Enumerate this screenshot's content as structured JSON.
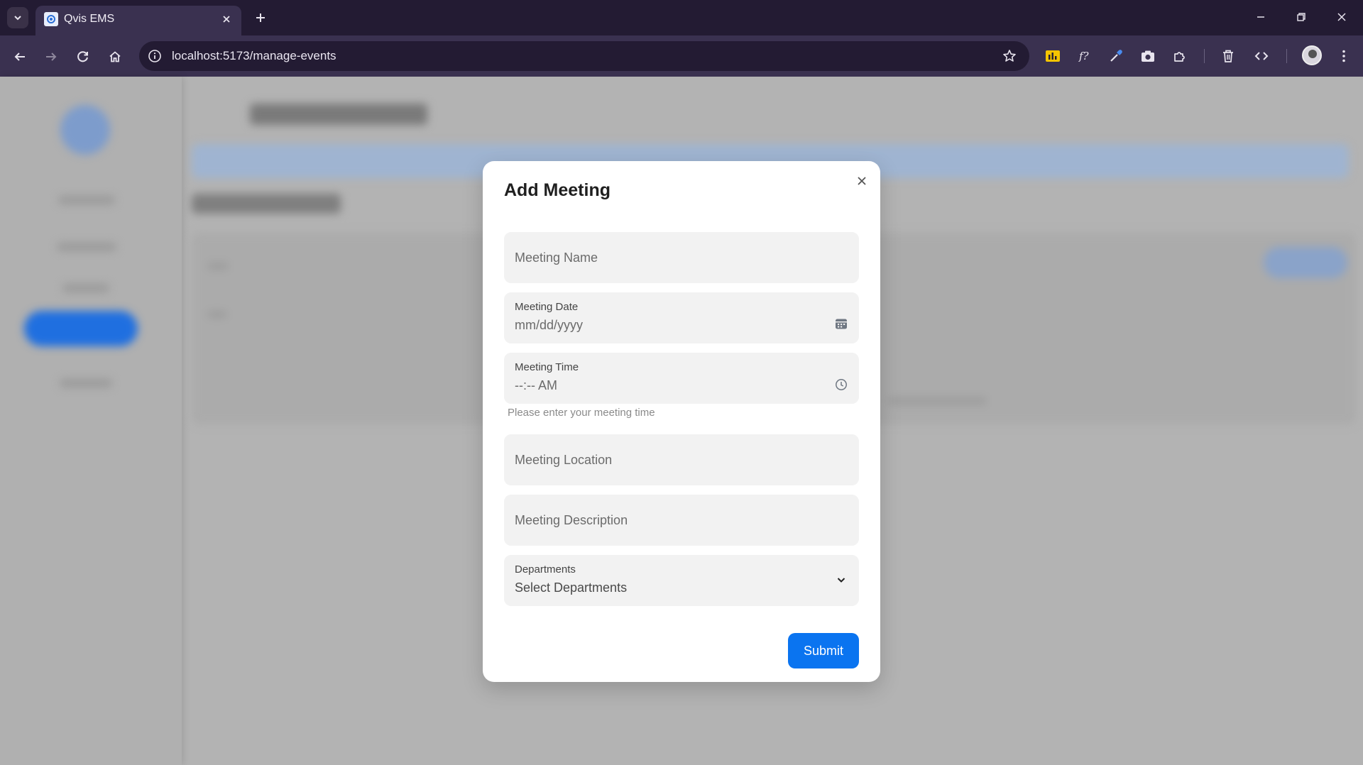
{
  "browser": {
    "tab_title": "Qvis EMS",
    "url": "localhost:5173/manage-events"
  },
  "modal": {
    "title": "Add Meeting",
    "meeting_name_placeholder": "Meeting Name",
    "meeting_date_label": "Meeting Date",
    "meeting_date_value": "mm/dd/yyyy",
    "meeting_time_label": "Meeting Time",
    "meeting_time_value": "--:-- AM",
    "meeting_time_helper": "Please enter your meeting time",
    "meeting_location_placeholder": "Meeting Location",
    "meeting_description_placeholder": "Meeting Description",
    "departments_label": "Departments",
    "departments_value": "Select Departments",
    "submit_label": "Submit"
  },
  "colors": {
    "accent": "#0a74f0",
    "overlay": "#b3b3b3",
    "browser_frame": "#231b33"
  },
  "icons": {
    "close": "close-icon",
    "calendar": "calendar-icon",
    "clock": "clock-icon",
    "chevron": "chevron-down-icon"
  }
}
